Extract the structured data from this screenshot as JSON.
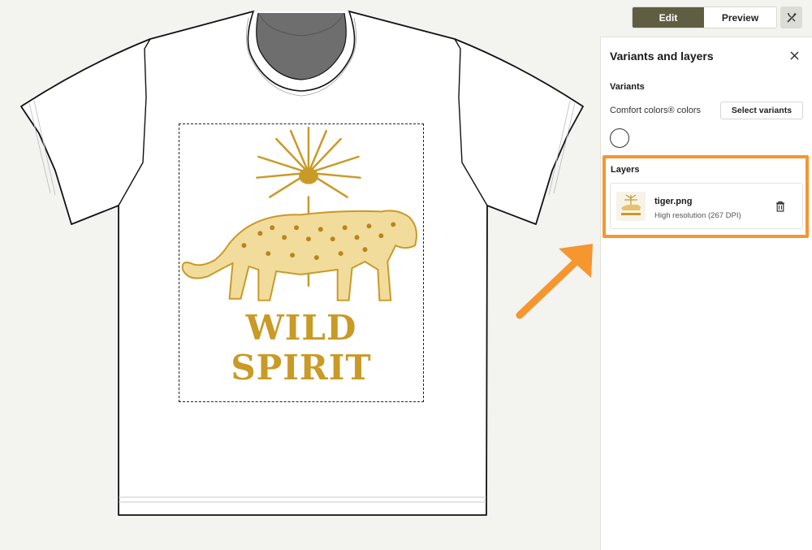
{
  "toolbar": {
    "edit_label": "Edit",
    "preview_label": "Preview",
    "tools_icon": "magic-tools-icon",
    "active_mode": "Edit",
    "active_color": "#5f5e42"
  },
  "canvas": {
    "product": "t-shirt",
    "shirt_color": "#ffffff",
    "design_text": "WILD SPIRIT",
    "design_color": "#c99a26"
  },
  "panel": {
    "title": "Variants and layers",
    "close_icon": "close-icon",
    "variants": {
      "heading": "Variants",
      "label": "Comfort colors® colors",
      "select_button": "Select variants",
      "selected_colors": [
        "#ffffff"
      ]
    },
    "layers": {
      "heading": "Layers",
      "highlight_color": "#f5962f",
      "items": [
        {
          "name": "tiger.png",
          "resolution": "High resolution (267 DPI)",
          "delete_icon": "trash-icon"
        }
      ]
    }
  },
  "annotation": {
    "arrow_color": "#f5962f"
  }
}
